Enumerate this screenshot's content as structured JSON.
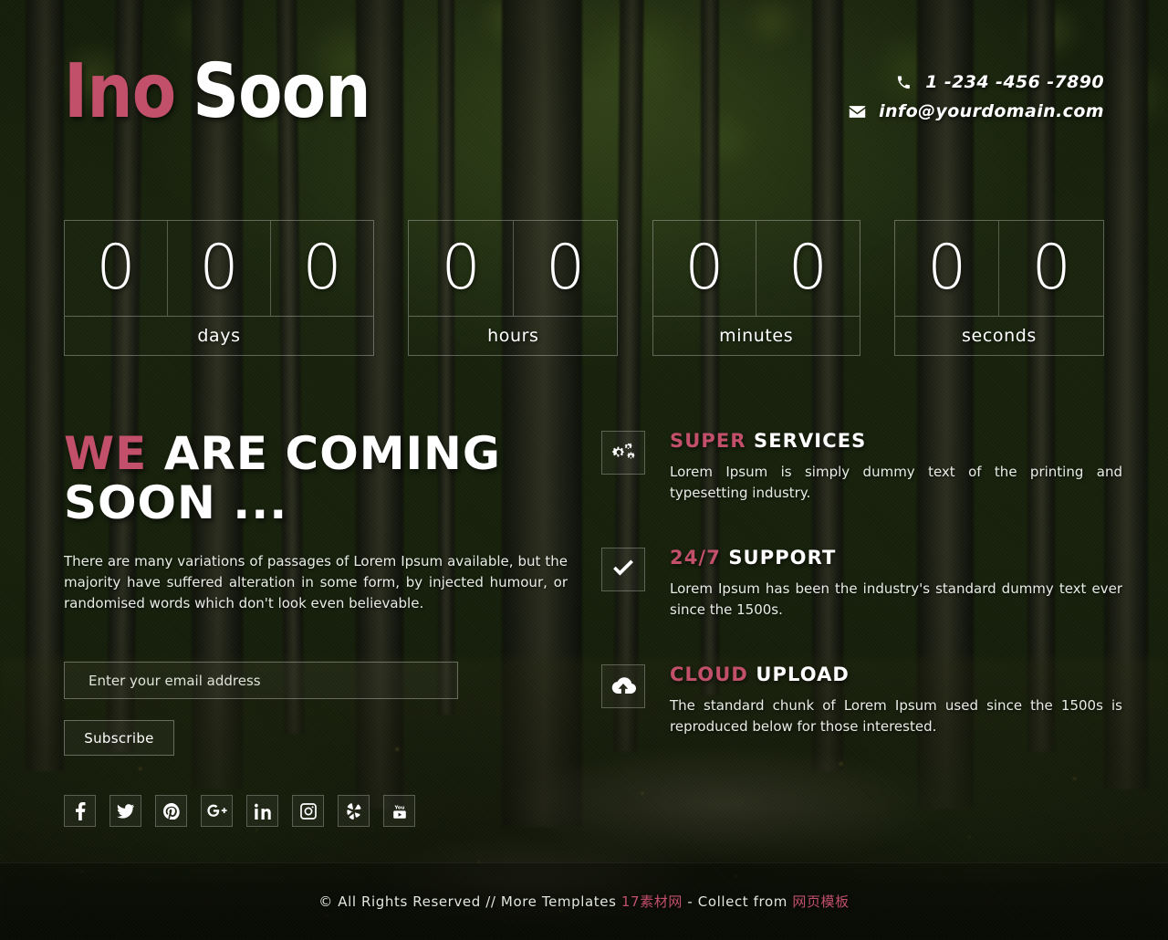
{
  "brand": {
    "logo_accent": "Ino",
    "logo_rest": "Soon",
    "accent_color": "#c2506a"
  },
  "contact": {
    "phone_icon": "phone-icon",
    "phone": "1 -234 -456 -7890",
    "email_icon": "envelope-icon",
    "email": "info@yourdomain.com"
  },
  "countdown": {
    "groups": [
      {
        "label": "days",
        "digits": [
          "0",
          "0",
          "0"
        ]
      },
      {
        "label": "hours",
        "digits": [
          "0",
          "0"
        ]
      },
      {
        "label": "minutes",
        "digits": [
          "0",
          "0"
        ]
      },
      {
        "label": "seconds",
        "digits": [
          "0",
          "0"
        ]
      }
    ]
  },
  "hero": {
    "headline_accent": "WE",
    "headline_rest": "ARE COMING SOON ...",
    "lead": "There are many variations of passages of Lorem Ipsum available, but the majority have suffered alteration in some form, by injected humour, or randomised words which don't look even believable."
  },
  "subscribe": {
    "placeholder": "Enter your email address",
    "value": "",
    "button_label": "Subscribe"
  },
  "features": [
    {
      "icon": "gears-icon",
      "title_accent": "SUPER",
      "title_rest": "SERVICES",
      "desc": "Lorem Ipsum is simply dummy text of the printing and typesetting industry."
    },
    {
      "icon": "check-icon",
      "title_accent": "24/7",
      "title_rest": "SUPPORT",
      "desc": "Lorem Ipsum has been the industry's standard dummy text ever since the 1500s."
    },
    {
      "icon": "cloud-upload-icon",
      "title_accent": "CLOUD",
      "title_rest": "UPLOAD",
      "desc": "The standard chunk of Lorem Ipsum used since the 1500s is reproduced below for those interested."
    }
  ],
  "social": [
    {
      "name": "facebook",
      "label": "Facebook"
    },
    {
      "name": "twitter",
      "label": "Twitter"
    },
    {
      "name": "pinterest",
      "label": "Pinterest"
    },
    {
      "name": "googleplus",
      "label": "Google Plus"
    },
    {
      "name": "linkedin",
      "label": "LinkedIn"
    },
    {
      "name": "instagram",
      "label": "Instagram"
    },
    {
      "name": "yelp",
      "label": "Yelp"
    },
    {
      "name": "youtube",
      "label": "YouTube"
    }
  ],
  "footer": {
    "text_before": "© All Rights Reserved // More Templates ",
    "link1": "17素材网",
    "text_middle": " - Collect from ",
    "link2": "网页模板"
  }
}
